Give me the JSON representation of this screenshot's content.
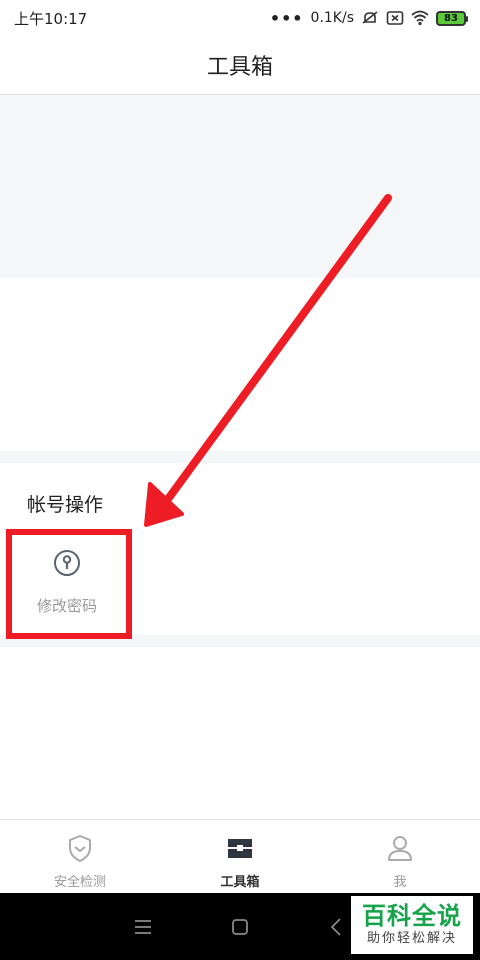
{
  "status_bar": {
    "time": "上午10:17",
    "dots": "•••",
    "net_speed": "0.1K/s",
    "battery": "83",
    "icons": [
      "mute-icon",
      "sim-icon",
      "wifi-icon",
      "battery-icon"
    ]
  },
  "header": {
    "title": "工具箱"
  },
  "account_section": {
    "title": "帐号操作",
    "items": [
      {
        "label": "修改密码",
        "icon": "key-icon"
      }
    ]
  },
  "tabs": [
    {
      "label": "安全检测",
      "icon": "shield-icon",
      "active": false
    },
    {
      "label": "工具箱",
      "icon": "toolbox-icon",
      "active": true
    },
    {
      "label": "我",
      "icon": "user-icon",
      "active": false
    }
  ],
  "nav_bar": {
    "buttons": [
      "menu-icon",
      "home-icon",
      "back-icon"
    ]
  },
  "watermark": {
    "title": "百科全说",
    "subtitle": "助你轻松解决"
  },
  "colors": {
    "annotation_red": "#ee1c25",
    "background_gray": "#f4f6f8",
    "battery_green": "#5ac93a",
    "watermark_green": "#16a34a"
  }
}
